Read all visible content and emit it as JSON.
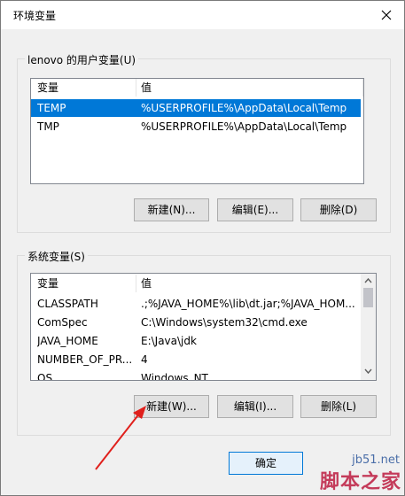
{
  "window": {
    "title": "环境变量"
  },
  "user_group": {
    "label": "lenovo 的用户变量(U)",
    "columns": [
      "变量",
      "值"
    ],
    "rows": [
      {
        "name": "TEMP",
        "value": "%USERPROFILE%\\AppData\\Local\\Temp"
      },
      {
        "name": "TMP",
        "value": "%USERPROFILE%\\AppData\\Local\\Temp"
      }
    ],
    "selected_index": 0,
    "buttons": {
      "new": "新建(N)...",
      "edit": "编辑(E)...",
      "delete": "删除(D)"
    }
  },
  "system_group": {
    "label": "系统变量(S)",
    "columns": [
      "变量",
      "值"
    ],
    "rows": [
      {
        "name": "CLASSPATH",
        "value": ".;%JAVA_HOME%\\lib\\dt.jar;%JAVA_HOM..."
      },
      {
        "name": "ComSpec",
        "value": "C:\\Windows\\system32\\cmd.exe"
      },
      {
        "name": "JAVA_HOME",
        "value": "E:\\Java\\jdk"
      },
      {
        "name": "NUMBER_OF_PR...",
        "value": "4"
      },
      {
        "name": "OS",
        "value": "Windows_NT"
      }
    ],
    "buttons": {
      "new": "新建(W)...",
      "edit": "编辑(I)...",
      "delete": "删除(L)"
    }
  },
  "footer": {
    "ok": "确定"
  },
  "watermark": {
    "site": "jb51.net",
    "text": "脚本之家"
  },
  "colors": {
    "selection": "#0078d7",
    "annotation_arrow": "#e0201c",
    "default_button_border": "#0078d7"
  }
}
